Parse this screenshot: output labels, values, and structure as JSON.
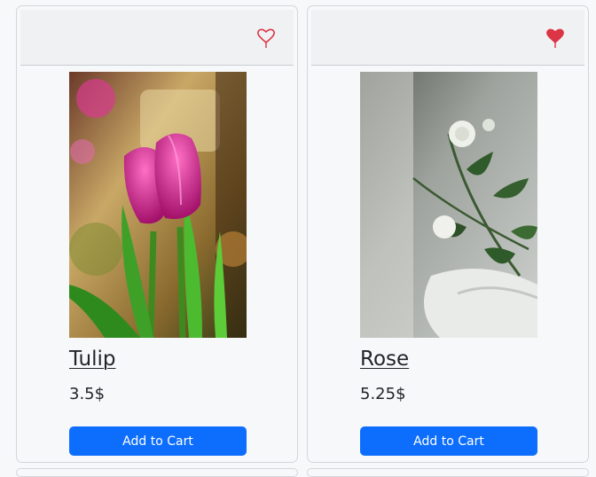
{
  "products": [
    {
      "name": "Tulip",
      "price": "3.5$",
      "button_label": "Add to Cart",
      "favorite": false,
      "heart_icon": "heart-outline-icon"
    },
    {
      "name": "Rose",
      "price": "5.25$",
      "button_label": "Add to Cart",
      "favorite": true,
      "heart_icon": "heart-filled-icon"
    }
  ],
  "colors": {
    "primary_button": "#0d6efd",
    "heart": "#dc3545",
    "card_header": "#f0f1f3",
    "background": "#f7f8fa"
  }
}
